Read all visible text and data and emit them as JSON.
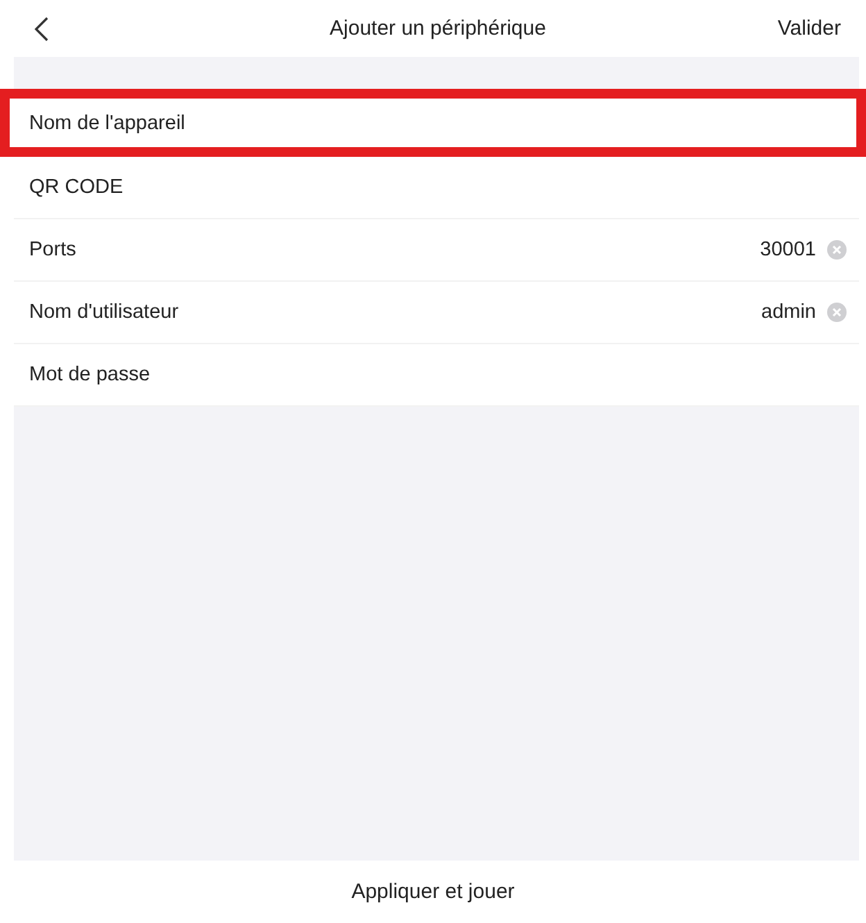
{
  "header": {
    "title": "Ajouter un périphérique",
    "action": "Valider"
  },
  "rows": [
    {
      "label": "Nom de l'appareil",
      "highlighted": true
    },
    {
      "label": "QR CODE",
      "highlighted": false
    },
    {
      "label": "Ports",
      "value": "30001",
      "highlighted": false
    },
    {
      "label": "Nom d'utilisateur",
      "value": "admin",
      "highlighted": false
    },
    {
      "label": "Mot de passe",
      "highlighted": false
    }
  ],
  "footer_button": "Appliquer et jouer"
}
